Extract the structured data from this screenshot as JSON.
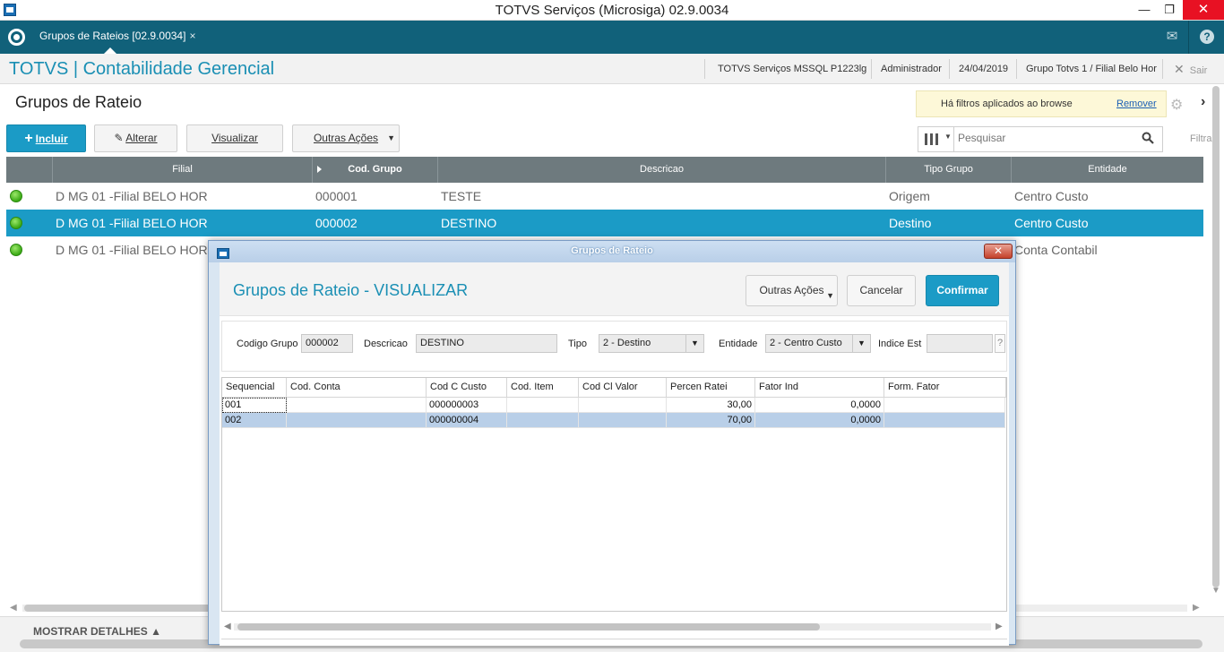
{
  "window": {
    "title": "TOTVS Serviços (Microsiga) 02.9.0034"
  },
  "tabbar": {
    "tab_label": "Grupos de Rateios [02.9.0034]",
    "tab_close": "×"
  },
  "module": {
    "title": "TOTVS | Contabilidade Gerencial",
    "environment": "TOTVS Serviços MSSQL P1223lg",
    "user": "Administrador",
    "date": "24/04/2019",
    "company": "Grupo Totvs 1 / Filial Belo Hor",
    "exit_label": "Sair"
  },
  "browse": {
    "title": "Grupos de Rateio",
    "buttons": {
      "incluir": "Incluir",
      "alterar": "Alterar",
      "visualizar": "Visualizar",
      "outras": "Outras Ações"
    },
    "filter_notice": "Há filtros aplicados ao browse",
    "filter_remove": "Remover",
    "search_placeholder": "Pesquisar",
    "filter_hint": "Filtra",
    "columns": [
      "Filial",
      "Cod. Grupo",
      "Descricao",
      "Tipo Grupo",
      "Entidade"
    ],
    "rows": [
      {
        "filial": "D MG 01 -Filial BELO HOR",
        "cod": "000001",
        "desc": "TESTE",
        "tipo": "Origem",
        "entidade": "Centro Custo"
      },
      {
        "filial": "D MG 01 -Filial BELO HOR",
        "cod": "000002",
        "desc": "DESTINO",
        "tipo": "Destino",
        "entidade": "Centro Custo"
      },
      {
        "filial": "D MG 01 -Filial BELO HOR",
        "cod": "",
        "desc": "",
        "tipo": "",
        "entidade": "Conta Contabil"
      }
    ],
    "selected_row": 1,
    "footer_label": "MOSTRAR DETALHES"
  },
  "dialog": {
    "window_title": "Grupos de Rateio",
    "title": "Grupos de Rateio - VISUALIZAR",
    "buttons": {
      "outras": "Outras Ações",
      "cancelar": "Cancelar",
      "confirmar": "Confirmar"
    },
    "form": {
      "codigo_label": "Codigo Grupo",
      "codigo_value": "000002",
      "descricao_label": "Descricao",
      "descricao_value": "DESTINO",
      "tipo_label": "Tipo",
      "tipo_value": "2 - Destino",
      "entidade_label": "Entidade",
      "entidade_value": "2 - Centro Custo",
      "indice_label": "Indice Est",
      "indice_value": "",
      "lookup_label": "?"
    },
    "grid": {
      "columns": [
        "Sequencial",
        "Cod. Conta",
        "Cod C Custo",
        "Cod. Item",
        "Cod Cl Valor",
        "Percen Ratei",
        "Fator Ind",
        "Form. Fator"
      ],
      "rows": [
        [
          "001",
          "",
          "000000003",
          "",
          "",
          "30,00",
          "0,0000",
          ""
        ],
        [
          "002",
          "",
          "000000004",
          "",
          "",
          "70,00",
          "0,0000",
          ""
        ]
      ],
      "selected_row": 1
    }
  },
  "colors": {
    "accent": "#1b9bc6",
    "tabbar": "#11617a",
    "grid_header": "#6e7a7e",
    "module_title": "#1a8fb4"
  }
}
